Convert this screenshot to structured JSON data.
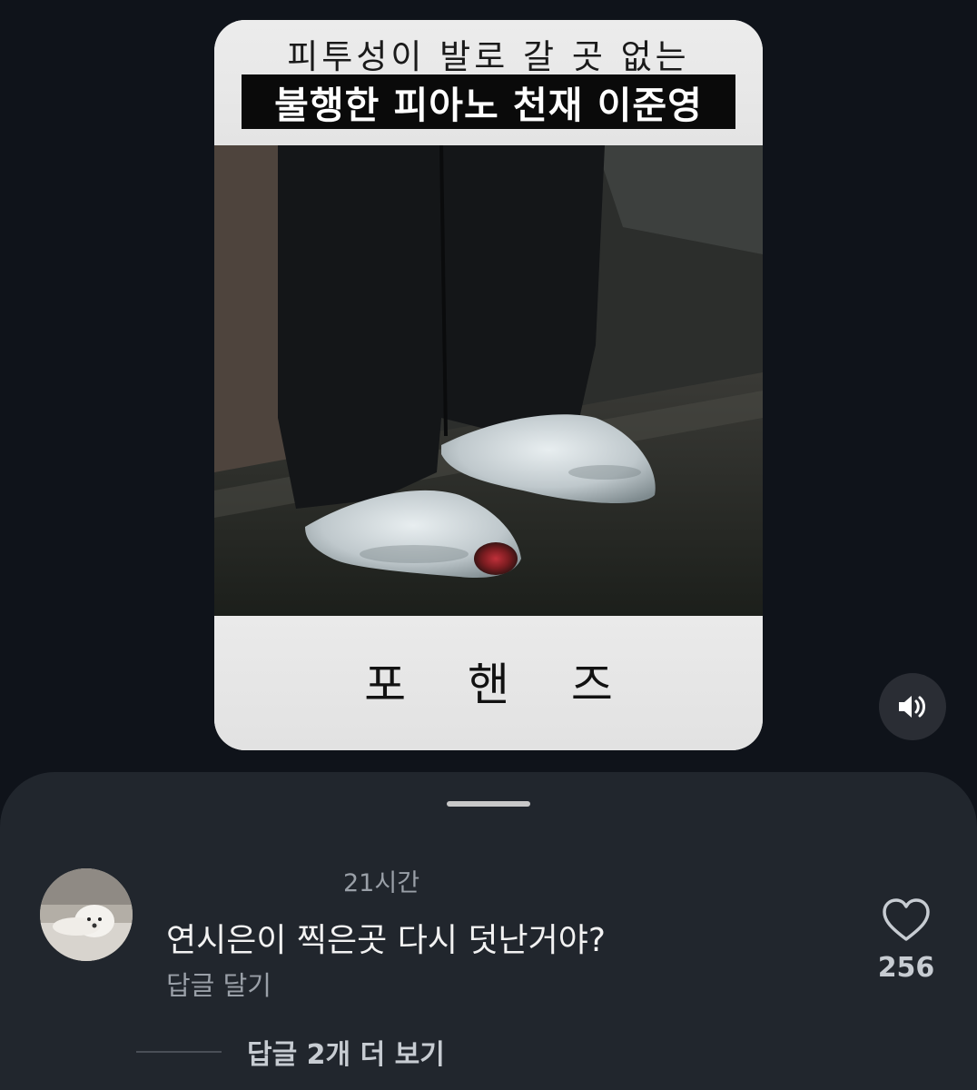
{
  "reel": {
    "subtitle": "피투성이 발로 갈 곳 없는",
    "headline": "불행한 피아노 천재 이준영",
    "brand": "포 핸 즈"
  },
  "controls": {
    "sound_icon": "speaker-volume-icon"
  },
  "comment": {
    "timestamp": "21시간",
    "text": "연시은이 찍은곳 다시 덧난거야?",
    "reply_label": "답글 달기",
    "like_count": "256",
    "like_icon": "heart-outline-icon",
    "more_replies_label": "답글 2개 더 보기"
  },
  "colors": {
    "background": "#0f131a",
    "sheet": "#21262d",
    "secondary_text": "#9aa0a8"
  }
}
